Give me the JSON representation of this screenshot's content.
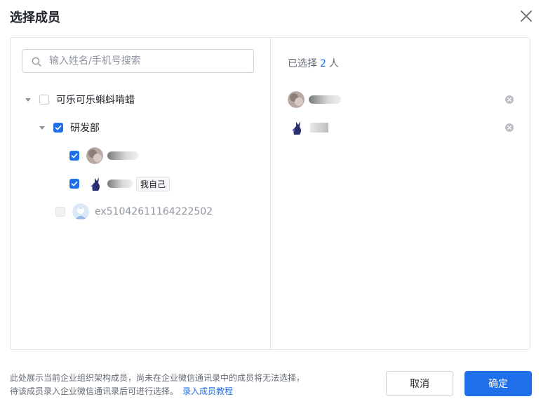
{
  "dialog": {
    "title": "选择成员"
  },
  "search": {
    "placeholder": "输入姓名/手机号搜索"
  },
  "tree": {
    "org_name": "可乐可乐蝌蚪啃蜡",
    "dept_name": "研发部",
    "self_tag": "我自己",
    "external_member": "ex51042611164222502"
  },
  "selected": {
    "prefix": "已选择",
    "count": "2",
    "suffix": "人"
  },
  "footer": {
    "note_line1": "此处展示当前企业组织架构成员，尚未在企业微信通讯录中的成员将无法选择，",
    "note_line2": "待该成员录入企业微信通讯录后可进行选择。",
    "link": "录入成员教程"
  },
  "buttons": {
    "cancel": "取消",
    "confirm": "确定"
  },
  "colors": {
    "accent": "#1f6feb",
    "border": "#e4e6eb",
    "muted": "#8f959e"
  },
  "icons": [
    "close-icon",
    "search-icon",
    "caret-down-icon",
    "checkbox-icon",
    "remove-icon",
    "avatar-icon"
  ]
}
